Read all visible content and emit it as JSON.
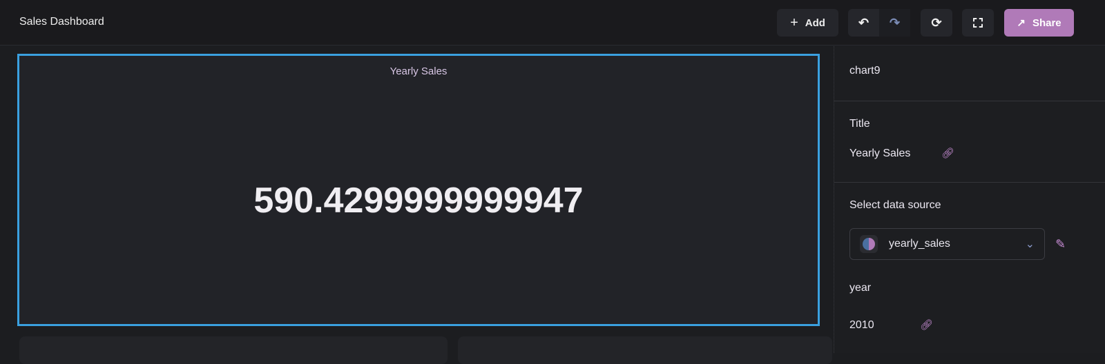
{
  "header": {
    "title": "Sales Dashboard",
    "add_label": "Add",
    "share_label": "Share",
    "accent": "#b07ab8"
  },
  "chart": {
    "title": "Yearly Sales",
    "value": "590.4299999999947",
    "selected_border": "#3aa0e0"
  },
  "panel": {
    "chart_id": "chart9",
    "title_label": "Title",
    "title_value": "Yearly Sales",
    "data_source_label": "Select data source",
    "data_source_value": "yearly_sales",
    "param_label": "year",
    "param_value": "2010"
  }
}
